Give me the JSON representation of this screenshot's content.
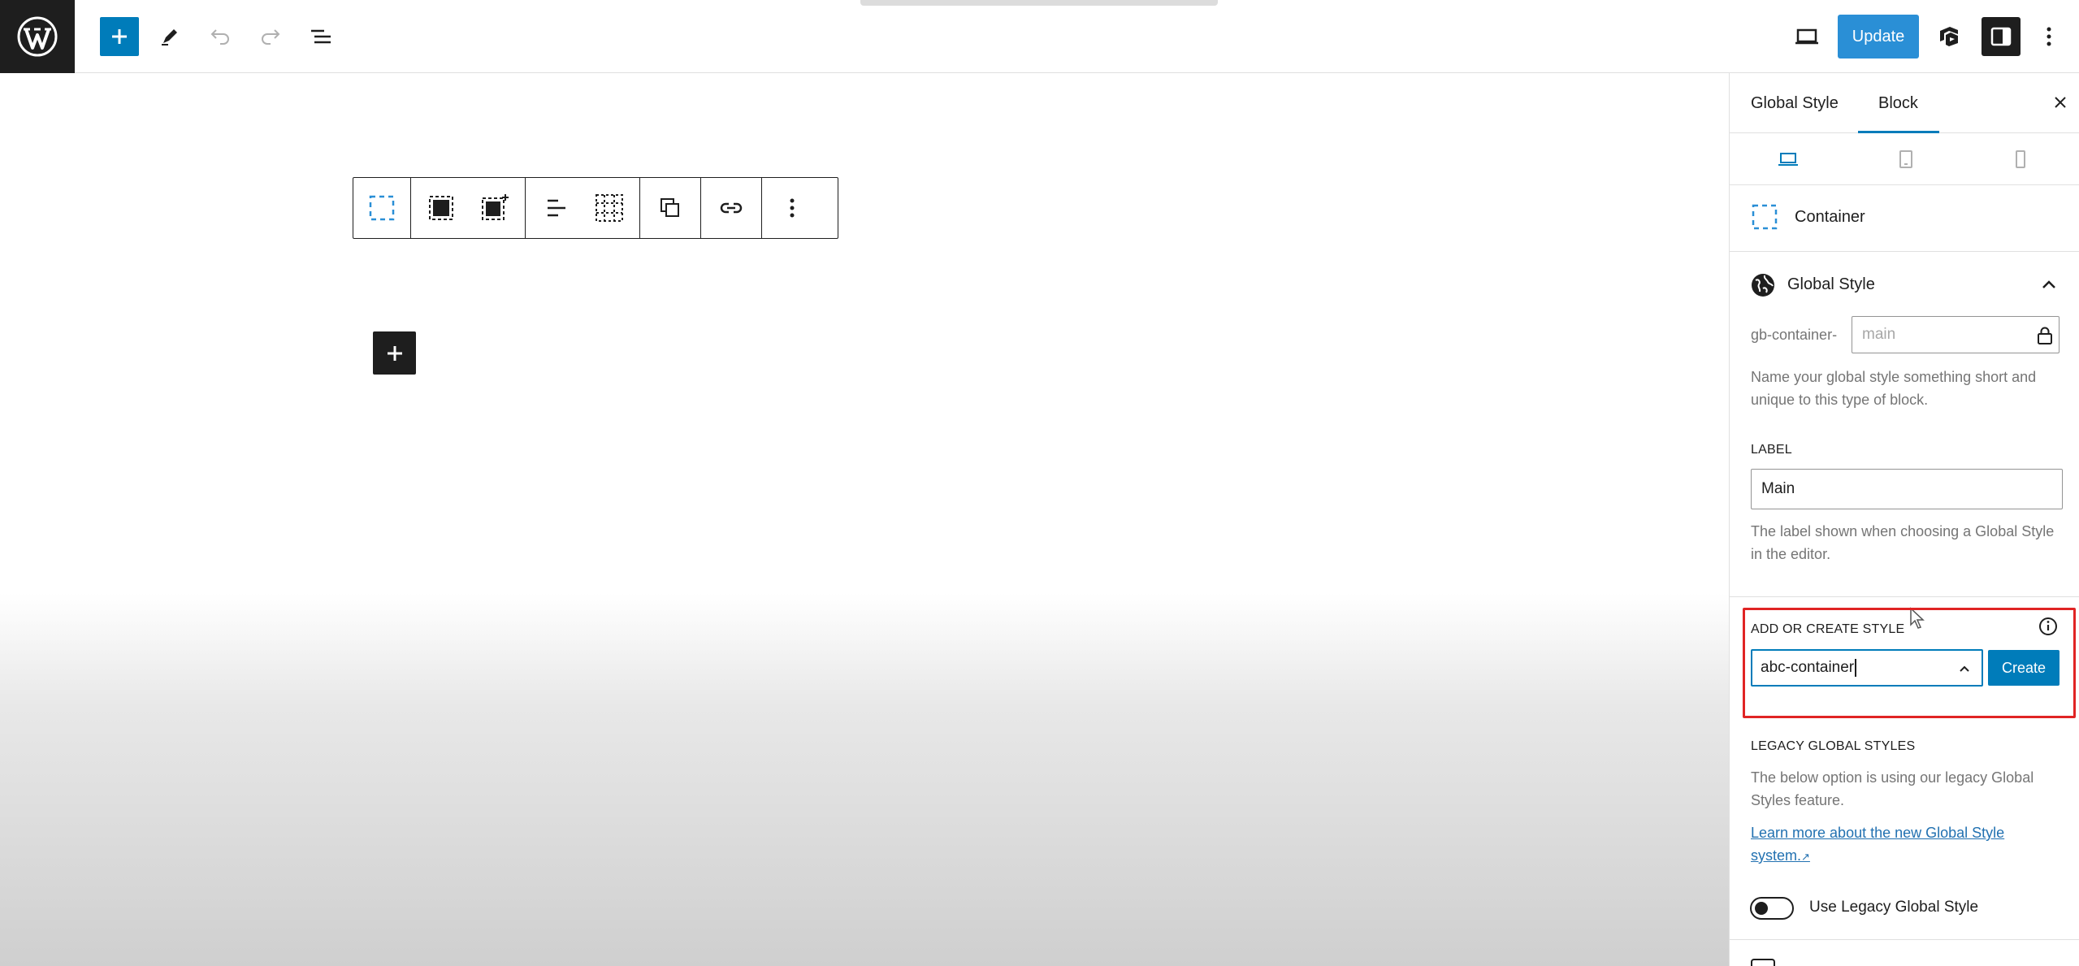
{
  "header": {
    "update_label": "Update"
  },
  "sidebar": {
    "tabs": [
      "Global Style",
      "Block"
    ],
    "block_name": "Container",
    "global_style_panel": {
      "title": "Global Style",
      "prefix": "gb-container-",
      "name_placeholder": "main",
      "name_help": [
        "Name your global style something short and",
        "unique to this type of block."
      ],
      "label_heading": "LABEL",
      "label_value": "Main",
      "label_help": [
        "The label shown when choosing a Global Style",
        "in the editor."
      ],
      "add_heading": "ADD OR CREATE STYLE",
      "add_value": "abc-container",
      "create_label": "Create",
      "legacy_heading": "LEGACY GLOBAL STYLES",
      "legacy_help": [
        "The below option is using our legacy Global",
        "Styles feature."
      ],
      "learn_more": [
        "Learn more about the new Global Style",
        "system."
      ],
      "legacy_toggle_label": "Use Legacy Global Style"
    }
  },
  "colors": {
    "accent": "#007cba",
    "highlight": "#e02424",
    "dark": "#1e1e1e"
  }
}
